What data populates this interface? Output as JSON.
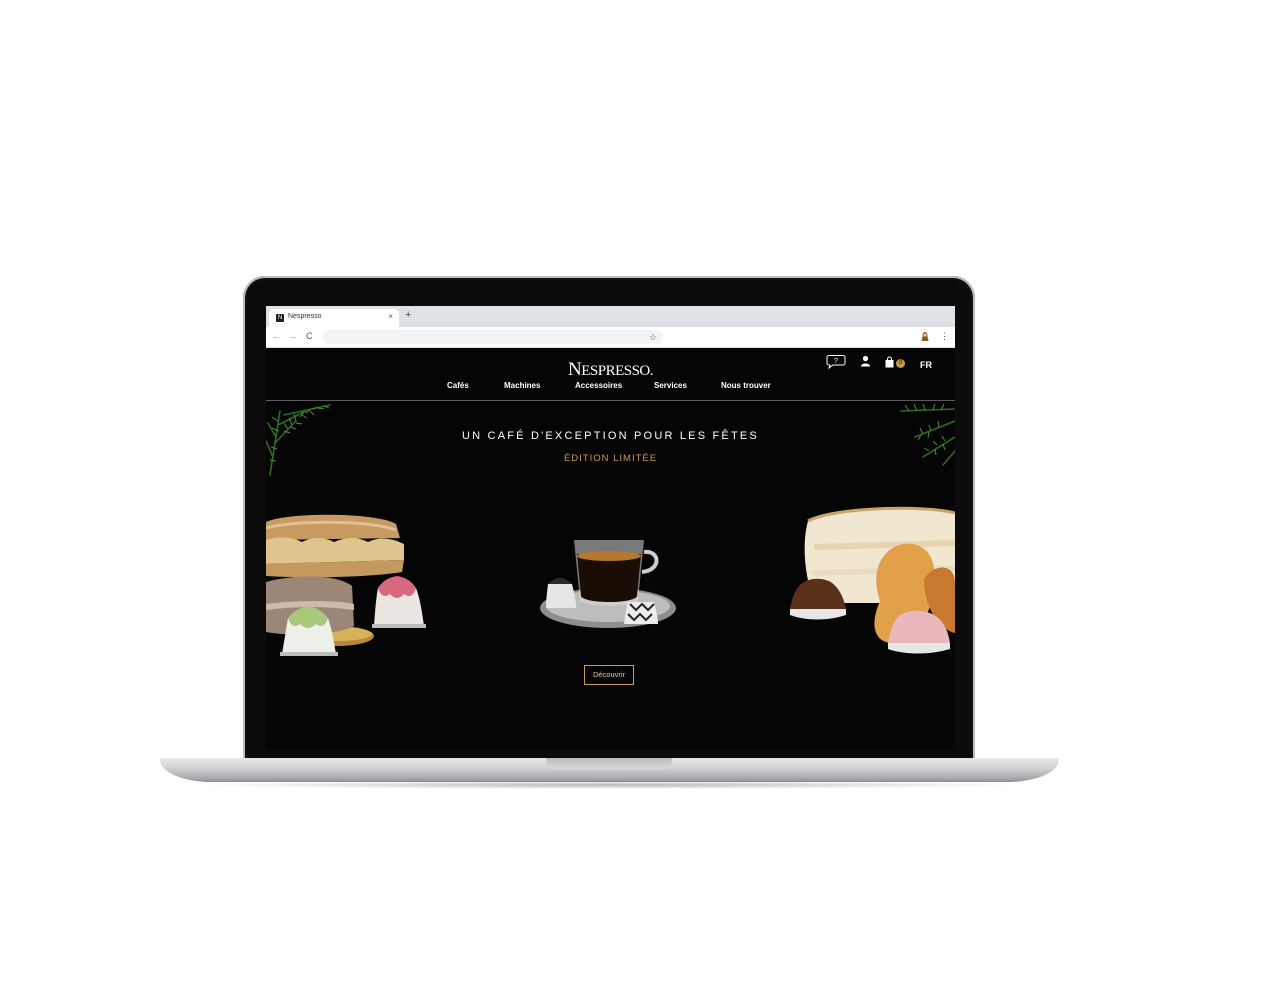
{
  "browser": {
    "tab_title": "Nespresso",
    "tab_close": "×",
    "new_tab": "+",
    "back": "←",
    "forward": "→",
    "reload": "C",
    "bookmark": "☆",
    "menu": "⋮"
  },
  "site": {
    "logo_initial": "N",
    "logo_rest": "ESPRESSO.",
    "cart_count": "0",
    "language": "FR",
    "nav": [
      {
        "label": "Cafés"
      },
      {
        "label": "Machines"
      },
      {
        "label": "Accessoires"
      },
      {
        "label": "Services"
      },
      {
        "label": "Nous trouver"
      }
    ]
  },
  "hero": {
    "headline": "UN CAFÉ D'EXCEPTION POUR LES FÊTES",
    "subline": "ÉDITION LIMITÉE",
    "cta_label": "Découvrir"
  },
  "colors": {
    "accent_gold": "#c99b4f",
    "background": "#050505"
  },
  "icons": [
    "chat-help-icon",
    "user-icon",
    "shopping-bag-icon"
  ]
}
